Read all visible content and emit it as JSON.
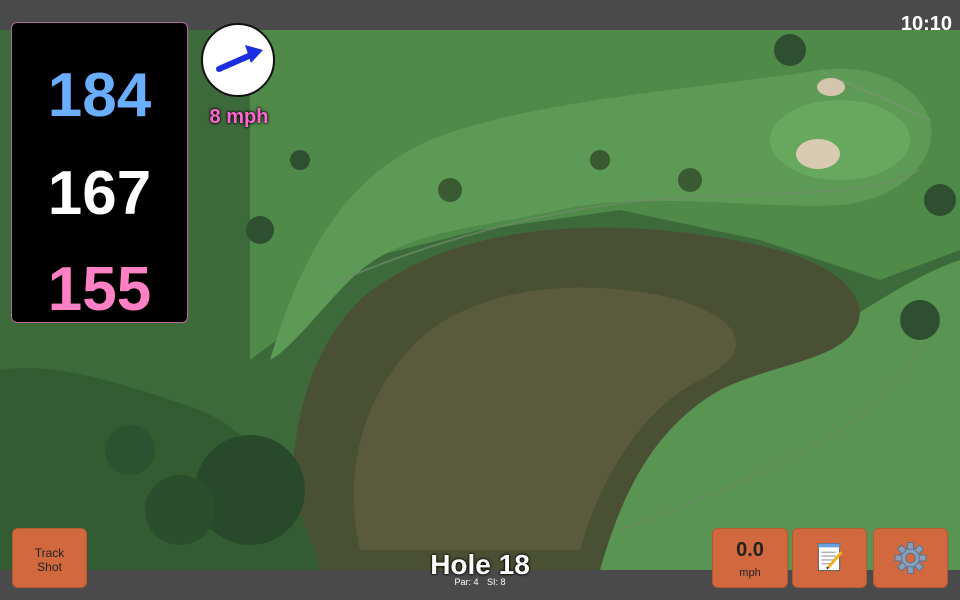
{
  "status": {
    "time": "10:10"
  },
  "distances": {
    "back": "184",
    "middle": "167",
    "front": "155"
  },
  "wind": {
    "speed_label": "8 mph",
    "arrow_icon": "arrow-right-icon"
  },
  "hole": {
    "title": "Hole 18",
    "par_label": "Par: 4",
    "si_label": "SI: 8"
  },
  "buttons": {
    "track_shot_line1": "Track",
    "track_shot_line2": "Shot",
    "wind_value": "0.0",
    "wind_unit": "mph",
    "notes_icon": "notepad-icon",
    "settings_icon": "gear-icon"
  },
  "colors": {
    "back_distance": "#6aaeff",
    "middle_distance": "#ffffff",
    "front_distance": "#ff80c4",
    "wind_speed": "#ff66d0",
    "button": "#d2693e"
  }
}
